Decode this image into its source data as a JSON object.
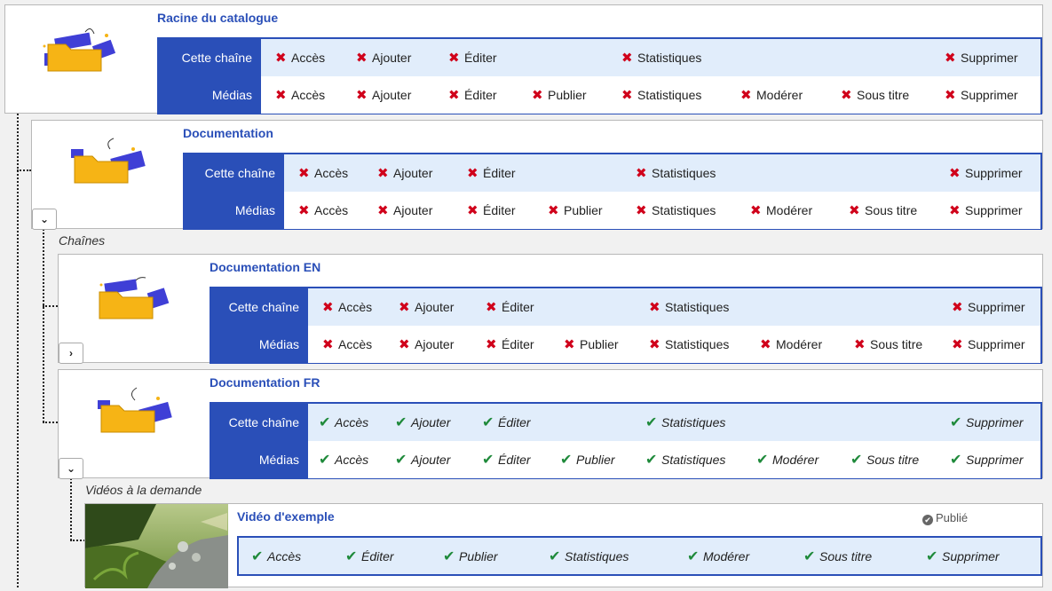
{
  "labels": {
    "channel": "Cette chaîne",
    "media": "Médias"
  },
  "sections": {
    "channels": "Chaînes",
    "vod": "Vidéos à la demande"
  },
  "perms": {
    "acces": "Accès",
    "ajouter": "Ajouter",
    "editer": "Éditer",
    "publier": "Publier",
    "statistiques": "Statistiques",
    "moderer": "Modérer",
    "sous_titre": "Sous titre",
    "supprimer": "Supprimer"
  },
  "colors": {
    "accent": "#2a4fb8",
    "deny": "#d0021b",
    "allow": "#1f8a3b",
    "row_tint": "#e1edfb"
  },
  "cards": {
    "root": {
      "title": "Racine du catalogue"
    },
    "doc": {
      "title": "Documentation",
      "toggle_icon": "chevron-down-icon"
    },
    "doc_en": {
      "title": "Documentation EN",
      "toggle_icon": "chevron-right-icon"
    },
    "doc_fr": {
      "title": "Documentation FR",
      "toggle_icon": "chevron-down-icon"
    },
    "video": {
      "title": "Vidéo d'exemple",
      "status": "Publié"
    }
  },
  "icons": {
    "deny": "x-icon",
    "allow": "check-icon"
  },
  "glyphs": {
    "deny": "✖",
    "allow": "✔",
    "down": "⌄",
    "right": "›",
    "check": "✔"
  }
}
